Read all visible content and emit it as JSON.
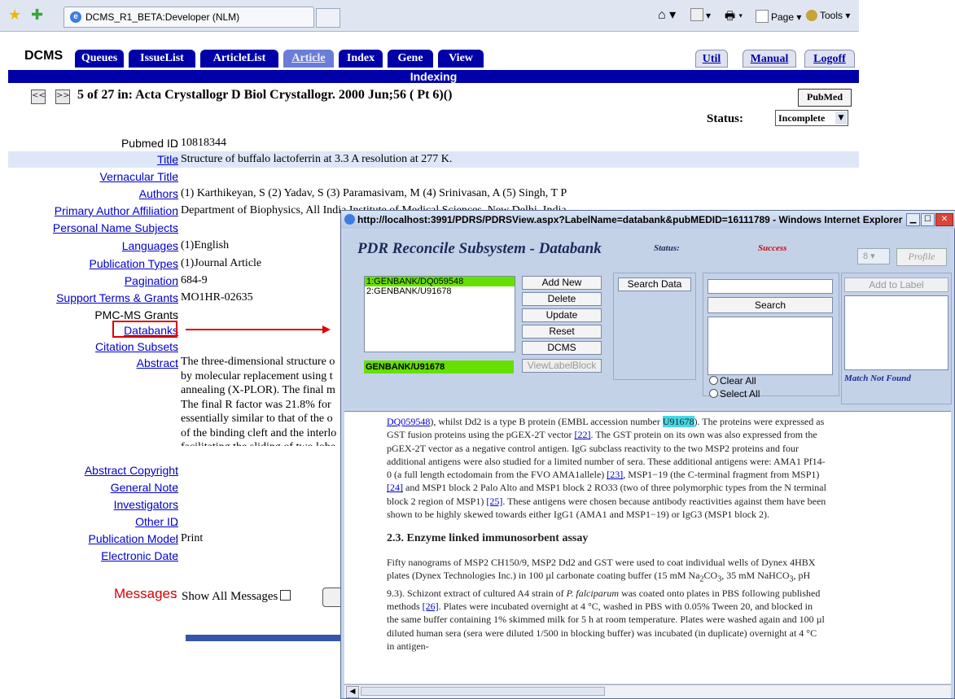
{
  "browser": {
    "tab_title": "DCMS_R1_BETA:Developer (NLM)",
    "commands": {
      "page": "Page",
      "tools": "Tools"
    }
  },
  "dcms": {
    "logo": "DCMS",
    "nav_tabs": [
      "Queues",
      "IssueList",
      "ArticleList",
      "Article",
      "Index",
      "Gene",
      "View"
    ],
    "active_tab": "Article",
    "right_tabs": [
      "Util",
      "Manual",
      "Logoff"
    ],
    "bar_title": "Indexing",
    "prev_symbol": "<<",
    "next_symbol": ">>",
    "journal_line": "5 of 27 in:  Acta Crystallogr D Biol Crystallogr. 2000 Jun;56 ( Pt 6)()",
    "pubmed_button": "PubMed",
    "status_label": "Status:",
    "status_value": "Incomplete",
    "fields": {
      "pubmed_id": {
        "label": "Pubmed ID",
        "value": "10818344"
      },
      "title": {
        "label": "Title",
        "value": "Structure of buffalo lactoferrin at 3.3 A resolution at 277 K."
      },
      "vernacular_title": {
        "label": "Vernacular Title",
        "value": ""
      },
      "authors": {
        "label": "Authors",
        "value": "(1) Karthikeyan, S   (2) Yadav, S   (3) Paramasivam, M   (4) Srinivasan, A   (5) Singh, T P"
      },
      "primary_author_affiliation": {
        "label": "Primary Author Affiliation",
        "value": "Department of Biophysics, All India Institute of Medical Sciences, New Delhi, India."
      },
      "personal_name_subjects": {
        "label": "Personal Name Subjects",
        "value": ""
      },
      "languages": {
        "label": "Languages",
        "value": "(1)English"
      },
      "publication_types": {
        "label": "Publication Types",
        "value": "(1)Journal Article"
      },
      "pagination": {
        "label": "Pagination",
        "value": "684-9"
      },
      "support_terms": {
        "label": "Support Terms & Grants",
        "value": "MO1HR-02635"
      },
      "pmc_ms_grants": {
        "label": "PMC-MS Grants",
        "value": ""
      },
      "databanks": {
        "label": "Databanks",
        "value": ""
      },
      "citation_subsets": {
        "label": "Citation Subsets",
        "value": ""
      },
      "abstract": {
        "label": "Abstract",
        "value": "The three-dimensional structure o\nby molecular replacement using t\nannealing (X-PLOR). The final m\nThe final R factor was 21.8% for\nessentially similar to that of the o\nof the binding cleft and the interlo\nfacilitating the sliding of two lobe"
      },
      "abstract_copyright": {
        "label": "Abstract Copyright",
        "value": ""
      },
      "general_note": {
        "label": "General Note",
        "value": ""
      },
      "investigators": {
        "label": "Investigators",
        "value": ""
      },
      "other_id": {
        "label": "Other ID",
        "value": ""
      },
      "publication_model": {
        "label": "Publication Model",
        "value": "Print"
      },
      "electronic_date": {
        "label": "Electronic Date",
        "value": ""
      }
    },
    "messages_label": "Messages",
    "show_all_messages": "Show All Messages"
  },
  "popup": {
    "window_title": "http://localhost:3991/PDRS/PDRSView.aspx?LabelName=databank&pubMEDID=16111789 - Windows Internet Explorer",
    "panel_title": "PDR Reconcile Subsystem - Databank",
    "status_label": "Status:",
    "status_value": "Success",
    "number_select": "8",
    "profile_button": "Profile",
    "list_items": [
      "1:GENBANK/DQ059548",
      "2:GENBANK/U91678"
    ],
    "selected_item": "GENBANK/U91678",
    "buttons": [
      "Add New",
      "Delete",
      "Update",
      "Reset",
      "DCMS",
      "ViewLabelBlock"
    ],
    "search_data_button": "Search Data",
    "search_button": "Search",
    "clear_all": "Clear All",
    "select_all": "Select All",
    "add_to_label_button": "Add to Label",
    "match_status": "Match Not Found",
    "document": {
      "p1_link_a": "DQ059548",
      "p1_a": "), whilst Dd2 is a type B protein (EMBL accession number ",
      "p1_highlight": "U91678",
      "p1_b": "). The proteins were expressed as GST fusion proteins using the pGEX-2T vector ",
      "ref22": "[22]",
      "p1_c": ". The GST protein on its own was also expressed from the pGEX-2T vector as a negative control antigen. IgG subclass reactivity to the two MSP2 proteins and four additional antigens were also studied for a limited number of sera. These additional antigens were: AMA1 Pf14-0 (a full length ectodomain from the FVO AMA1allele) ",
      "ref23": "[23]",
      "p1_d": ", MSP1−19 (the C-terminal fragment from MSP1) ",
      "ref24": "[24]",
      "p1_e": " and MSP1 block 2 Palo Alto and MSP1 block 2 RO33 (two of three polymorphic types from the N terminal block 2 region of MSP1) ",
      "ref25": "[25]",
      "p1_f": ". These antigens were chosen because antibody reactivities against them have been shown to be highly skewed towards either IgG1 (AMA1 and MSP1−19) or IgG3 (MSP1 block 2).",
      "heading": "2.3. Enzyme linked immunosorbent assay",
      "p2_a": "Fifty nanograms of MSP2 CH150/9, MSP2 Dd2 and GST were used to coat individual wells of Dynex 4HBX plates (Dynex Technologies Inc.) in 100 µl carbonate coating buffer (15 mM Na",
      "p2_sub1": "2",
      "p2_b": "CO",
      "p2_sub2": "3",
      "p2_c": ", 35 mM NaHCO",
      "p2_sub3": "3",
      "p2_d": ", pH 9.3). Schizont extract of cultured A4 strain of ",
      "p2_italic": "P. falciparum",
      "p2_e": " was coated onto plates in PBS following published methods ",
      "ref26": "[26]",
      "p2_f": ". Plates were incubated overnight at 4 °C, washed in PBS with 0.05% Tween 20, and blocked in the same buffer containing 1% skimmed milk for 5 h at room temperature. Plates were washed again and 100 µl diluted human sera (sera were diluted 1/500 in blocking buffer) was incubated (in duplicate) overnight at 4 °C in antigen-"
    }
  }
}
